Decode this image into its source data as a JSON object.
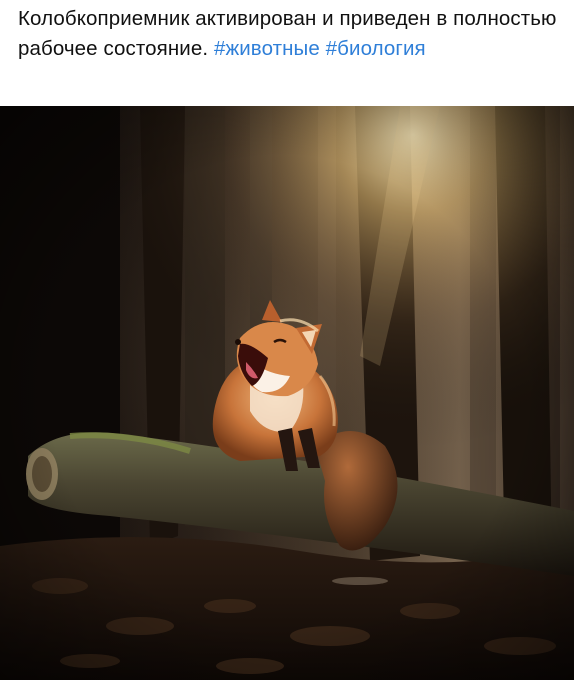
{
  "post": {
    "text": "Колобкоприемник активирован и приведен в полностью рабочее состояние.",
    "hashtags": [
      "#животные",
      "#биология"
    ],
    "link_color": "#2f7fd8"
  },
  "photo": {
    "subject": "fox-yawning-on-log-in-forest"
  }
}
